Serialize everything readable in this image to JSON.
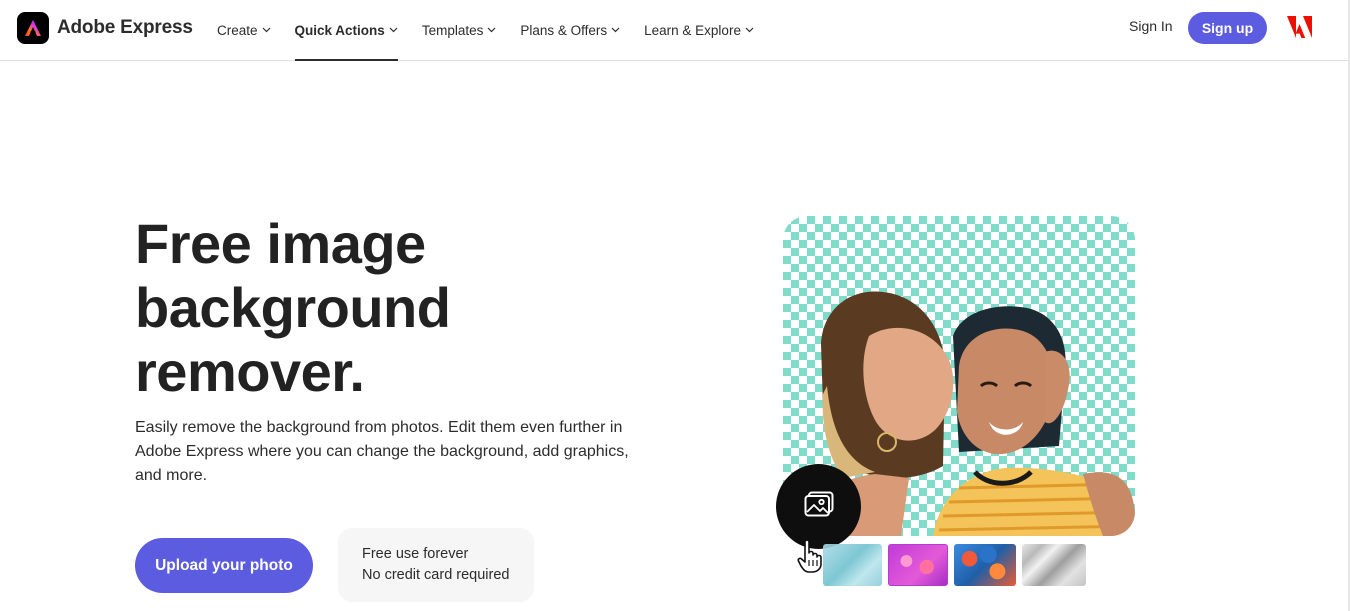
{
  "brand": {
    "name": "Adobe Express",
    "logo_icon": "adobe-express-logo-icon"
  },
  "nav": {
    "items": [
      {
        "label": "Create",
        "active": false
      },
      {
        "label": "Quick Actions",
        "active": true
      },
      {
        "label": "Templates",
        "active": false
      },
      {
        "label": "Plans & Offers",
        "active": false
      },
      {
        "label": "Learn & Explore",
        "active": false
      }
    ],
    "sign_in": "Sign In",
    "sign_up": "Sign up",
    "adobe_icon": "adobe-logo-icon"
  },
  "hero": {
    "title_lines": [
      "Free image",
      "background",
      "remover."
    ],
    "description": "Easily remove the background from photos. Edit them even further in Adobe Express where you can change the background, add graphics, and more.",
    "upload_button": "Upload your photo",
    "info": {
      "line1": "Free use forever",
      "line2": "No credit card required"
    }
  },
  "illustration": {
    "fab_icon": "image-icon",
    "cursor_icon": "hand-pointer-icon",
    "thumbnails": [
      "thumbnail-teal",
      "thumbnail-pink",
      "thumbnail-floral",
      "thumbnail-silver"
    ]
  },
  "colors": {
    "accent": "#5c5ce0",
    "checker": "#7fdccb",
    "text": "#2c2c2c"
  }
}
